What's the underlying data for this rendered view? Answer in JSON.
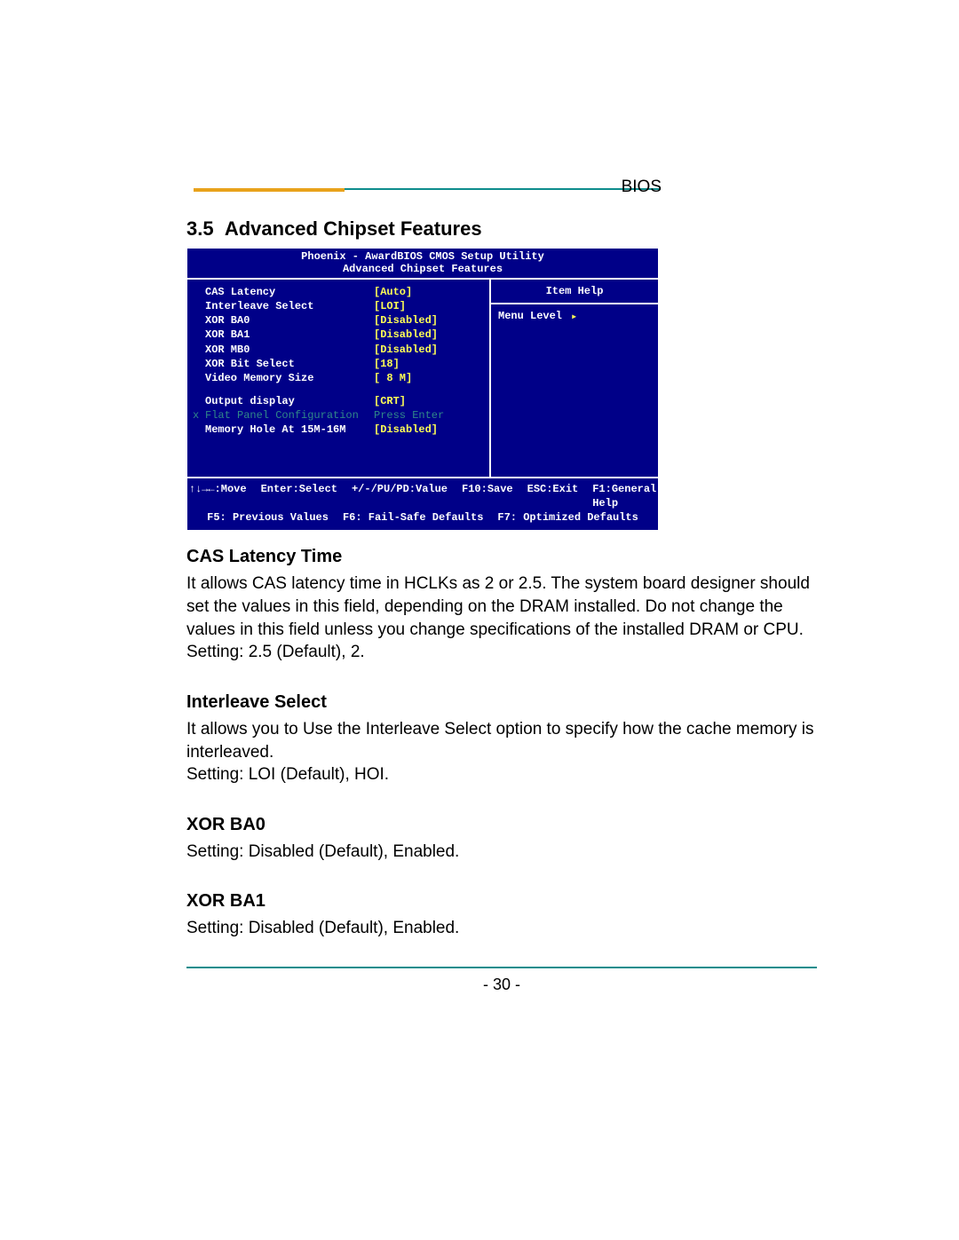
{
  "header": {
    "label": "BIOS"
  },
  "section": {
    "number": "3.5",
    "title": "Advanced Chipset Features"
  },
  "bios": {
    "title_line1": "Phoenix - AwardBIOS CMOS Setup Utility",
    "title_line2": "Advanced Chipset Features",
    "rows": [
      {
        "label": "CAS Latency",
        "value": "[Auto]",
        "dim": false
      },
      {
        "label": "Interleave Select",
        "value": "[LOI]",
        "dim": false
      },
      {
        "label": "XOR BA0",
        "value": "[Disabled]",
        "dim": false
      },
      {
        "label": "XOR BA1",
        "value": "[Disabled]",
        "dim": false
      },
      {
        "label": "XOR MB0",
        "value": "[Disabled]",
        "dim": false
      },
      {
        "label": "XOR Bit Select",
        "value": "[18]",
        "dim": false
      },
      {
        "label": "Video Memory Size",
        "value": "[  8 M]",
        "dim": false
      },
      {
        "label": "",
        "value": "",
        "dim": false,
        "spacer": true
      },
      {
        "label": "Output display",
        "value": "[CRT]",
        "dim": false
      },
      {
        "label": "Flat Panel Configuration",
        "value": "Press Enter",
        "dim": true
      },
      {
        "label": "Memory Hole At 15M-16M",
        "value": "[Disabled]",
        "dim": false
      }
    ],
    "help_title": "Item Help",
    "menu_level_label": "Menu Level",
    "footer": {
      "line1": [
        "↑↓→←:Move",
        "Enter:Select",
        "+/-/PU/PD:Value",
        "F10:Save",
        "ESC:Exit",
        "F1:General Help"
      ],
      "line2": [
        "F5: Previous Values",
        "F6: Fail-Safe Defaults",
        "F7: Optimized Defaults"
      ]
    }
  },
  "doc": [
    {
      "title": "CAS Latency Time",
      "body": "It allows CAS latency time in HCLKs as 2 or 2.5. The system board designer should set the values in this field, depending on the DRAM installed. Do not change the values in this field unless you change specifications of the installed DRAM or CPU.\nSetting: 2.5 (Default), 2."
    },
    {
      "title": "Interleave Select",
      "body": "It allows you to Use the Interleave Select option to specify how the cache memory is interleaved.\nSetting: LOI (Default), HOI."
    },
    {
      "title": "XOR BA0",
      "body": "Setting: Disabled (Default), Enabled."
    },
    {
      "title": "XOR BA1",
      "body": "Setting: Disabled (Default), Enabled."
    }
  ],
  "page_number": "- 30 -"
}
